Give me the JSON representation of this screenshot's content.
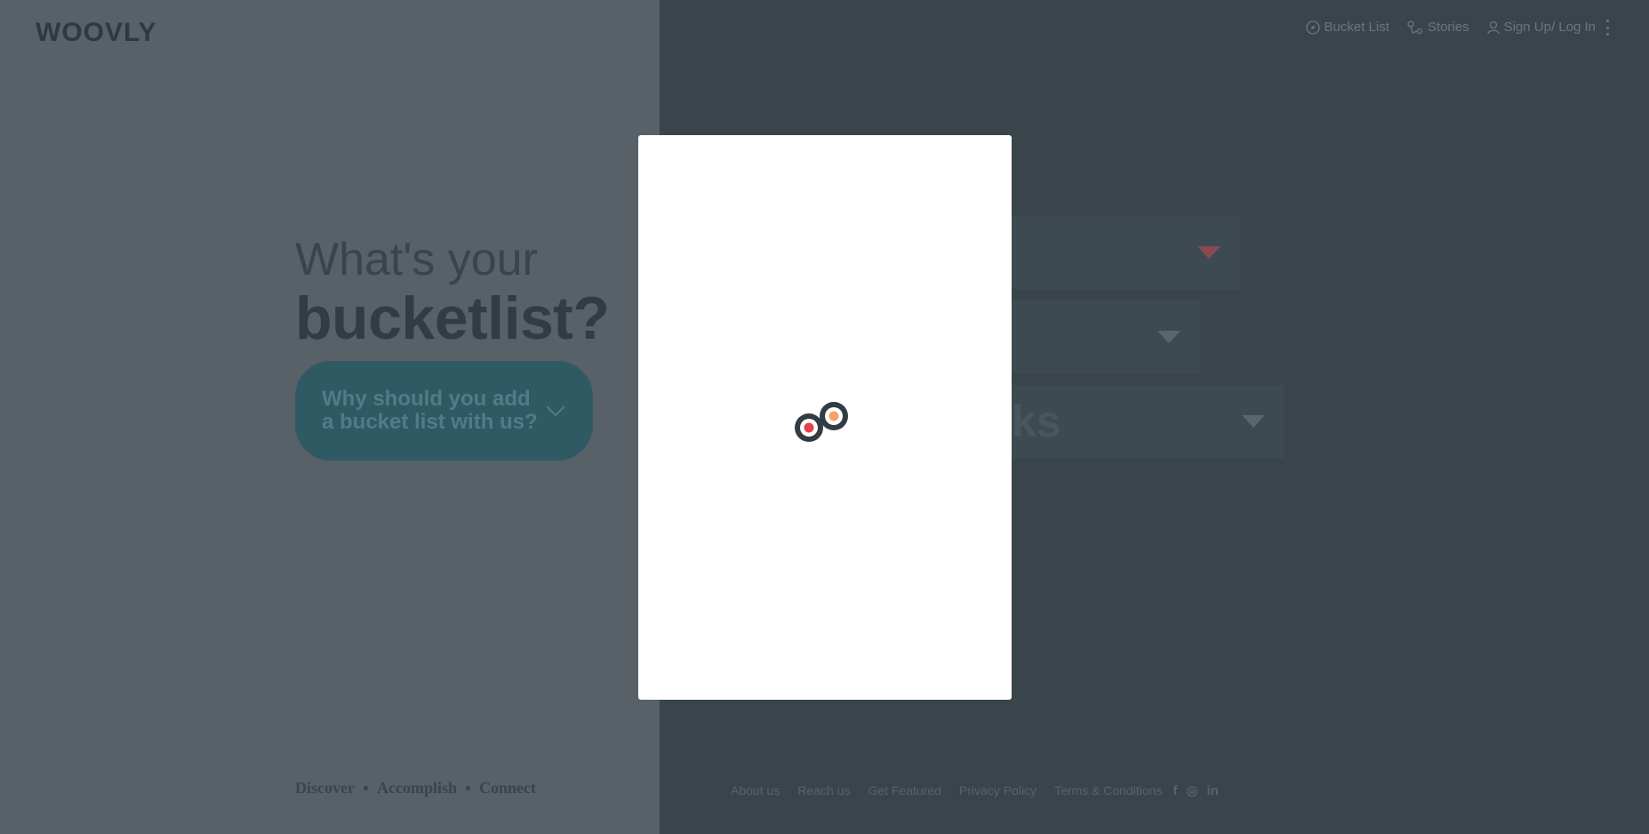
{
  "brand": {
    "logo_text": "WOOVLY"
  },
  "topnav": {
    "items": [
      {
        "label": "Bucket List",
        "icon": "compass-icon"
      },
      {
        "label": "Stories",
        "icon": "route-icon"
      },
      {
        "label": "Sign Up/ Log In",
        "icon": "user-icon"
      }
    ],
    "more_icon": "kebab-menu-icon"
  },
  "hero": {
    "line1": "What's your",
    "line2": "bucketlist?"
  },
  "why_card": {
    "text": "Why should you add a bucket list with us?"
  },
  "dropdowns": {
    "third_partial_text": "ks"
  },
  "tagline": {
    "items": [
      "Discover",
      "Accomplish",
      "Connect"
    ]
  },
  "footer": {
    "links": [
      "About us",
      "Reach us",
      "Get Featured",
      "Privacy Policy",
      "Terms & Conditions"
    ],
    "social": [
      {
        "icon": "facebook-icon",
        "glyph": "f"
      },
      {
        "icon": "instagram-icon",
        "glyph": "◎"
      },
      {
        "icon": "linkedin-icon",
        "glyph": "in"
      }
    ]
  },
  "modal": {
    "state": "loading",
    "loader_icon": "loading-spinner-icon"
  },
  "colors": {
    "left_bg": "#586068",
    "right_bg": "#3a454b",
    "accent_red": "#e8404a",
    "accent_orange": "#f5a36b",
    "card_teal": "#2f5a63"
  }
}
